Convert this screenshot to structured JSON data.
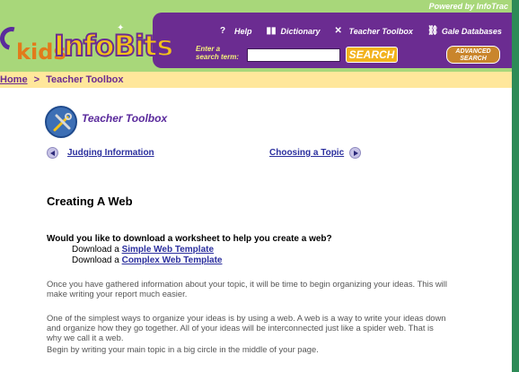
{
  "header": {
    "powered_by": "Powered by InfoTrac",
    "logo_kids": "kids",
    "logo_infobits": "InfoBits",
    "nav": [
      {
        "label": "Help",
        "icon": "question-icon"
      },
      {
        "label": "Dictionary",
        "icon": "book-icon"
      },
      {
        "label": "Teacher Toolbox",
        "icon": "tools-icon"
      },
      {
        "label": "Gale Databases",
        "icon": "link-icon"
      }
    ],
    "search_label": "Enter a search term:",
    "search_value": "",
    "search_button": "SEARCH",
    "advanced_button": "ADVANCED SEARCH"
  },
  "breadcrumb": {
    "home": "Home",
    "separator": ">",
    "current": "Teacher Toolbox"
  },
  "section": {
    "title": "Teacher Toolbox"
  },
  "pager": {
    "prev": "Judging Information",
    "next": "Choosing a Topic"
  },
  "page": {
    "heading": "Creating A Web",
    "question": "Would you like to download a worksheet to help you create a web?",
    "download_prefix": "Download a",
    "simple_link": "Simple Web Template",
    "complex_link": "Complex Web Template",
    "p1_line1": "Once you have gathered information about your topic, it will be time to begin organizing your ideas. This will",
    "p1_line2": "make writing your report much easier.",
    "p2_line1": "One of the simplest ways to organize your ideas is by using a web. A web is a way to write your ideas down",
    "p2_line2": "and organize how they go together. All of your ideas will be interconnected just like a spider web. That is",
    "p2_line3": "why we call it a web.",
    "p3_line1": "Begin by writing your main topic in a big circle in the middle of your page."
  },
  "colors": {
    "header_green": "#a8d77a",
    "nav_purple": "#6b2c91",
    "breadcrumb_yellow": "#ffe79b",
    "link_blue": "#2b2f9e",
    "search_orange": "#f2b21d"
  }
}
